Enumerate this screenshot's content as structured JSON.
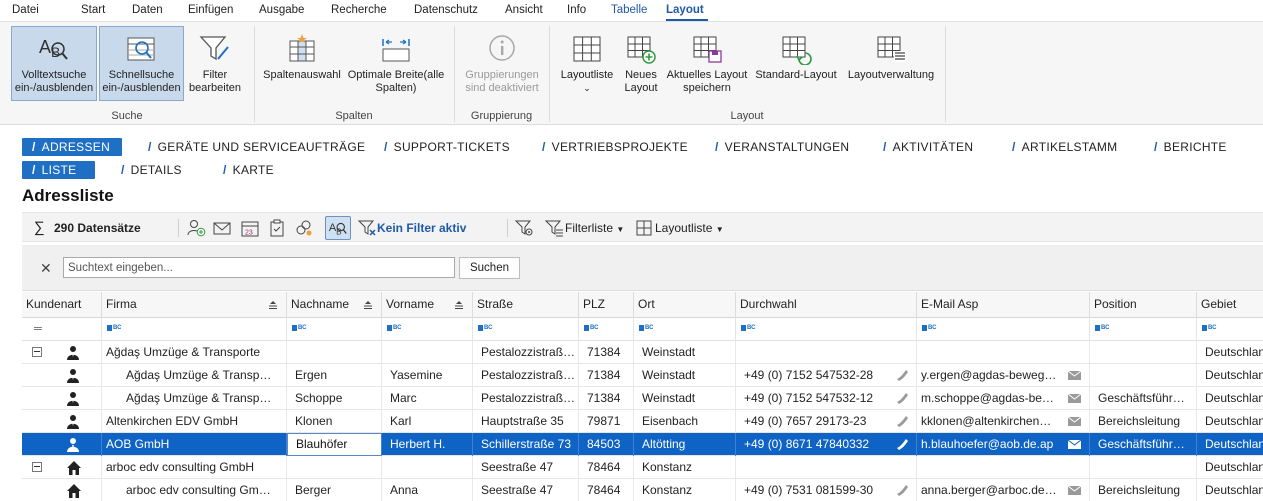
{
  "menu": [
    "Datei",
    "Start",
    "Daten",
    "Einfügen",
    "Ausgabe",
    "Recherche",
    "Datenschutz",
    "Ansicht",
    "Info",
    "Tabelle",
    "Layout"
  ],
  "ribbon": {
    "fulltext": "Volltextsuche\nein-/ausblenden",
    "fulltext_l1": "Volltextsuche",
    "fulltext_l2": "ein-/ausblenden",
    "quick_l1": "Schnellsuche",
    "quick_l2": "ein-/ausblenden",
    "filter_l1": "Filter",
    "filter_l2": "bearbeiten",
    "group_search": "Suche",
    "col_select": "Spaltenauswahl",
    "opt_width_l1": "Optimale Breite(alle",
    "opt_width_l2": "Spalten)",
    "group_columns": "Spalten",
    "grouping_l1": "Gruppierungen",
    "grouping_l2": "sind deaktiviert",
    "group_grouping": "Gruppierung",
    "layout_list": "Layoutliste",
    "new_layout_l1": "Neues",
    "new_layout_l2": "Layout",
    "save_layout_l1": "Aktuelles Layout",
    "save_layout_l2": "speichern",
    "std_layout": "Standard-Layout",
    "layout_mgmt": "Layoutverwaltung",
    "group_layout": "Layout"
  },
  "nav1": [
    "ADRESSEN",
    "GERÄTE UND SERVICEAUFTRÄGE",
    "SUPPORT-TICKETS",
    "VERTRIEBSPROJEKTE",
    "VERANSTALTUNGEN",
    "AKTIVITÄTEN",
    "ARTIKELSTAMM",
    "BERICHTE"
  ],
  "nav2": [
    "LISTE",
    "DETAILS",
    "KARTE"
  ],
  "page_title": "Adressliste",
  "toolbar": {
    "count": "290 Datensätze",
    "filter_status": "Kein Filter aktiv",
    "filter_list": "Filterliste",
    "layout_list": "Layoutliste"
  },
  "search": {
    "placeholder": "Suchtext eingeben...",
    "button": "Suchen"
  },
  "columns": [
    "Kundenart",
    "Firma",
    "Nachname",
    "Vorname",
    "Straße",
    "PLZ",
    "Ort",
    "Durchwahl",
    "E-Mail Asp",
    "Position",
    "Gebiet"
  ],
  "rows": [
    {
      "kind": "group",
      "firma": "Ağdaş Umzüge & Transporte",
      "nachname": "",
      "vorname": "",
      "strasse": "Pestalozzistraß…",
      "plz": "71384",
      "ort": "Weinstadt",
      "tel": "",
      "mail": "",
      "position": "",
      "gebiet": "Deutschland"
    },
    {
      "kind": "child",
      "firma": "Ağdaş Umzüge & Transp…",
      "nachname": "Ergen",
      "vorname": "Yasemine",
      "strasse": "Pestalozzistraß…",
      "plz": "71384",
      "ort": "Weinstadt",
      "tel": "+49 (0) 7152 547532-28",
      "mail": "y.ergen@agdas-beweg…",
      "position": "",
      "gebiet": "Deutschland"
    },
    {
      "kind": "child",
      "firma": "Ağdaş Umzüge & Transp…",
      "nachname": "Schoppe",
      "vorname": "Marc",
      "strasse": "Pestalozzistraß…",
      "plz": "71384",
      "ort": "Weinstadt",
      "tel": "+49 (0) 7152 547532-12",
      "mail": "m.schoppe@agdas-be…",
      "position": "Geschäftsführ…",
      "gebiet": "Deutschland"
    },
    {
      "kind": "single",
      "firma": "Altenkirchen EDV GmbH",
      "nachname": "Klonen",
      "vorname": "Karl",
      "strasse": "Hauptstraße 35",
      "plz": "79871",
      "ort": "Eisenbach",
      "tel": "+49 (0) 7657 29173-23",
      "mail": "kklonen@altenkirchen…",
      "position": "Bereichsleitung",
      "gebiet": "Deutschland"
    },
    {
      "kind": "selected",
      "firma": "AOB GmbH",
      "nachname": "Blauhöfer",
      "vorname": "Herbert H.",
      "strasse": "Schillerstraße 73",
      "plz": "84503",
      "ort": "Altötting",
      "tel": "+49 (0) 8671 47840332",
      "mail": "h.blauhoefer@aob.de.ap",
      "position": "Geschäftsführ…",
      "gebiet": "Deutschland"
    },
    {
      "kind": "group2",
      "firma": "arboc edv consulting GmbH",
      "nachname": "",
      "vorname": "",
      "strasse": "Seestraße 47",
      "plz": "78464",
      "ort": "Konstanz",
      "tel": "",
      "mail": "",
      "position": "",
      "gebiet": "Deutschland"
    },
    {
      "kind": "child2",
      "firma": "arboc edv consulting Gm…",
      "nachname": "Berger",
      "vorname": "Anna",
      "strasse": "Seestraße 47",
      "plz": "78464",
      "ort": "Konstanz",
      "tel": "+49 (0) 7531 081599-30",
      "mail": "anna.berger@arboc.de…",
      "position": "Bereichsleitung",
      "gebiet": "Deutschland"
    }
  ],
  "colors": {
    "accent": "#1f6fc5",
    "selected_row": "#0f63c4",
    "menu_active": "#1f5aa6"
  }
}
